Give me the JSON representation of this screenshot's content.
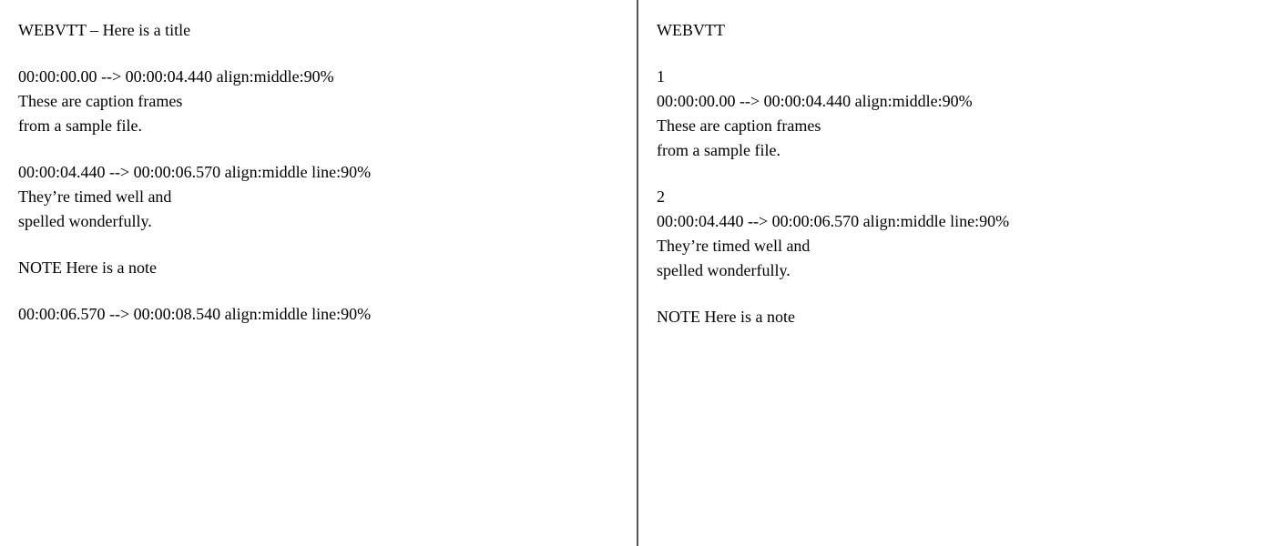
{
  "left_panel": {
    "blocks": [
      {
        "id": "left-block-1",
        "lines": [
          "WEBVTT – Here is a title"
        ]
      },
      {
        "id": "left-block-2",
        "lines": [
          "00:00:00.00 --> 00:00:04.440 align:middle:90%",
          "These are caption frames",
          "from a sample file."
        ]
      },
      {
        "id": "left-block-3",
        "lines": [
          "00:00:04.440 --> 00:00:06.570 align:middle line:90%",
          "They’re timed well and",
          "spelled wonderfully."
        ]
      },
      {
        "id": "left-block-4",
        "lines": [
          "NOTE Here is a note"
        ]
      },
      {
        "id": "left-block-5",
        "lines": [
          "00:00:06.570 --> 00:00:08.540 align:middle line:90%"
        ]
      }
    ]
  },
  "right_panel": {
    "blocks": [
      {
        "id": "right-block-1",
        "lines": [
          "WEBVTT"
        ]
      },
      {
        "id": "right-block-2",
        "lines": [
          "1",
          "00:00:00.00 --> 00:00:04.440 align:middle:90%",
          "These are caption frames",
          "from a sample file."
        ]
      },
      {
        "id": "right-block-3",
        "lines": [
          "2",
          "00:00:04.440 --> 00:00:06.570 align:middle line:90%",
          "They’re timed well and",
          "spelled wonderfully."
        ]
      },
      {
        "id": "right-block-4",
        "lines": [
          "NOTE Here is a note"
        ]
      }
    ]
  }
}
